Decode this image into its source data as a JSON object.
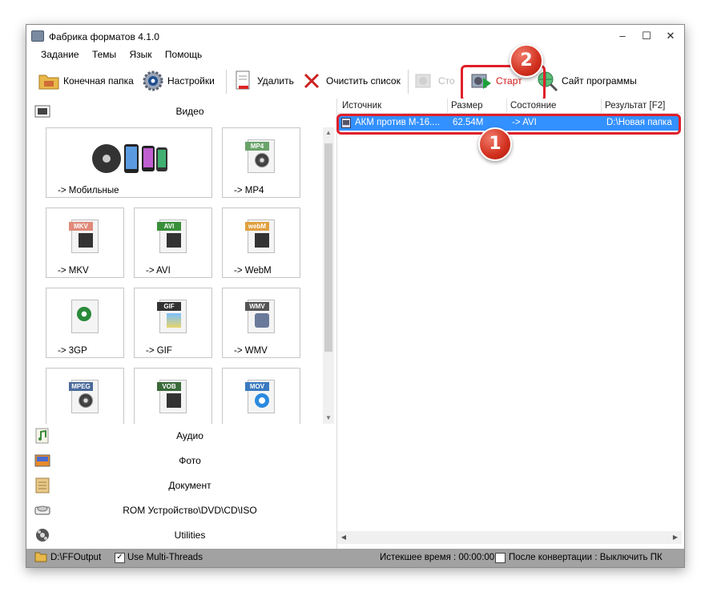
{
  "window": {
    "title": "Фабрика форматов 4.1.0",
    "minimize": "–",
    "maximize": "☐",
    "close": "✕"
  },
  "menu": [
    "Задание",
    "Темы",
    "Язык",
    "Помощь"
  ],
  "toolbar": {
    "output_folder": "Конечная папка",
    "settings": "Настройки",
    "delete": "Удалить",
    "clear_list": "Очистить список",
    "stop": "Сто",
    "start": "Старт",
    "website": "Сайт программы"
  },
  "categories": {
    "video": "Видео",
    "audio": "Аудио",
    "photo": "Фото",
    "document": "Документ",
    "rom": "ROM Устройство\\DVD\\CD\\ISO",
    "utilities": "Utilities"
  },
  "tiles": [
    {
      "label": "-> Мобильные",
      "icon": "mobile-devices-icon"
    },
    {
      "label": "-> MP4",
      "icon": "mp4-file-icon",
      "tag": "MP4",
      "color": "#6aa36a"
    },
    {
      "label": "-> MKV",
      "icon": "mkv-file-icon",
      "tag": "MKV",
      "color": "#e08a7a"
    },
    {
      "label": "-> AVI",
      "icon": "avi-file-icon",
      "tag": "AVI",
      "color": "#3a8f3a"
    },
    {
      "label": "-> WebM",
      "icon": "webm-file-icon",
      "tag": "webM",
      "color": "#e0a040"
    },
    {
      "label": "-> 3GP",
      "icon": "3gp-file-icon",
      "tag": "",
      "color": "#3a8f3a"
    },
    {
      "label": "-> GIF",
      "icon": "gif-file-icon",
      "tag": "GIF",
      "color": "#333333"
    },
    {
      "label": "-> WMV",
      "icon": "wmv-file-icon",
      "tag": "WMV",
      "color": "#555555"
    },
    {
      "label": "",
      "icon": "mpeg-file-icon",
      "tag": "MPEG",
      "color": "#4a6a9a"
    },
    {
      "label": "",
      "icon": "vob-file-icon",
      "tag": "VOB",
      "color": "#3a6a3a"
    },
    {
      "label": "",
      "icon": "mov-file-icon",
      "tag": "MOV",
      "color": "#3a7ac0"
    }
  ],
  "columns": [
    "Источник",
    "Размер",
    "Состояние",
    "Результат [F2]"
  ],
  "rows": [
    {
      "source": "АКМ против М-16....",
      "size": "62.54M",
      "state": "-> AVI",
      "result": "D:\\Новая папка"
    }
  ],
  "badges": {
    "one": "1",
    "two": "2"
  },
  "status": {
    "output_path": "D:\\FFOutput",
    "multithread_label": "Use Multi-Threads",
    "multithread_checked": true,
    "elapsed": "Истекшее время : 00:00:00",
    "after_label": "После конвертации : Выключить ПК",
    "after_checked": false
  },
  "colors": {
    "selection": "#3390ff",
    "callout": "#e0202a",
    "statusbar": "#a2a2a2"
  }
}
